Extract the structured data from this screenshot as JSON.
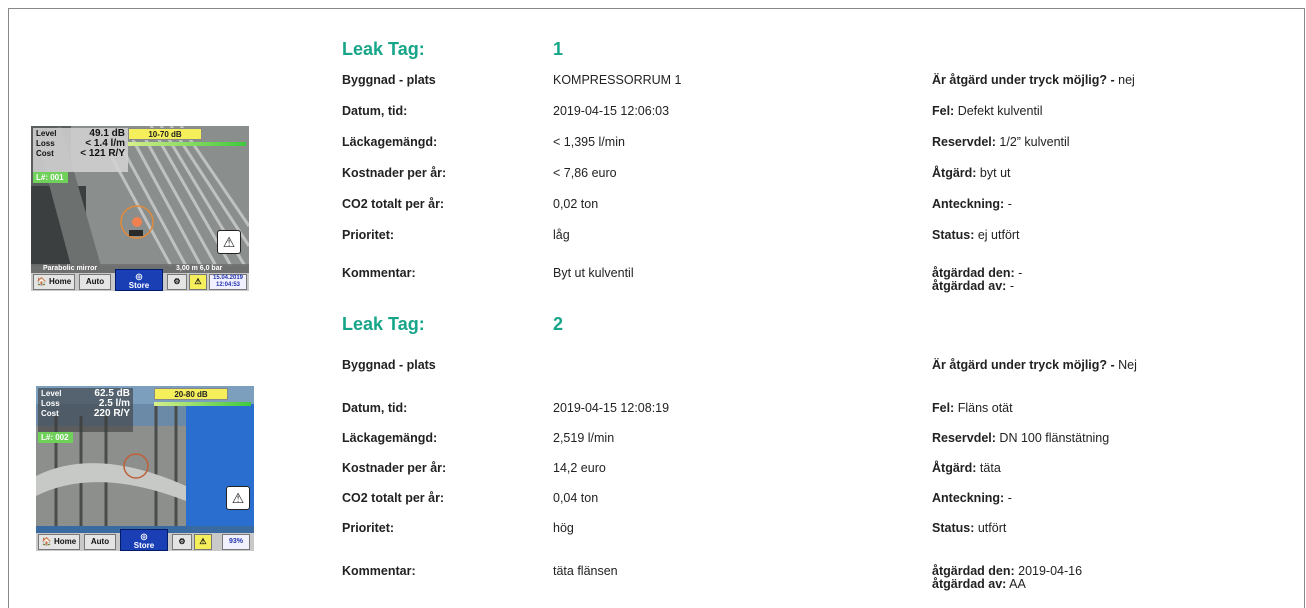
{
  "entries": [
    {
      "tag_label": "Leak Tag:",
      "tag_number": "1",
      "fields": {
        "building_label": "Byggnad - plats",
        "building_value": "KOMPRESSORRUM 1",
        "datetime_label": "Datum, tid:",
        "datetime_value": "2019-04-15 12:06:03",
        "leak_label": "Läckagemängd:",
        "leak_value": "< 1,395 l/min",
        "cost_label": "Kostnader per år:",
        "cost_value": "< 7,86 euro",
        "co2_label": "CO2 totalt per år:",
        "co2_value": "0,02 ton",
        "priority_label": "Prioritet:",
        "priority_value": "låg",
        "comment_label": "Kommentar:",
        "comment_value": "Byt ut kulventil"
      },
      "right": {
        "pressure_label": "Är åtgärd under tryck möjlig? -",
        "pressure_value": " nej",
        "fault_label": "Fel:",
        "fault_value": " Defekt kulventil",
        "part_label": "Reservdel:",
        "part_value": " 1/2” kulventil",
        "action_label": "Åtgärd:",
        "action_value": " byt ut",
        "note_label": "Anteckning:",
        "note_value": " -",
        "status_label": "Status:",
        "status_value": " ej utfört",
        "fixed_date_label": "åtgärdad den:",
        "fixed_date_value": " -",
        "fixed_by_label": "åtgärdad av:",
        "fixed_by_value": " -"
      },
      "thumbnail": {
        "level_label": "Level",
        "level_value": "49.1 dB",
        "loss_label": "Loss",
        "loss_value": "< 1.4 l/m",
        "cost_label": "Cost",
        "cost_value": "< 121 R/Y",
        "lnum": "L#: 001",
        "range": "10-70 dB",
        "mode_left": "Parabolic mirror",
        "mode_right": "3,00 m    6,0 bar",
        "home": "Home",
        "auto": "Auto",
        "store": "Store",
        "date_line1": "15.04.2019",
        "date_line2": "12:04:53"
      }
    },
    {
      "tag_label": "Leak Tag:",
      "tag_number": "2",
      "fields": {
        "building_label": "Byggnad - plats",
        "building_value": "",
        "datetime_label": "Datum, tid:",
        "datetime_value": "2019-04-15 12:08:19",
        "leak_label": "Läckagemängd:",
        "leak_value": "2,519 l/min",
        "cost_label": "Kostnader per år:",
        "cost_value": "14,2 euro",
        "co2_label": "CO2 totalt per år:",
        "co2_value": "0,04 ton",
        "priority_label": "Prioritet:",
        "priority_value": "hög",
        "comment_label": "Kommentar:",
        "comment_value": "täta flänsen"
      },
      "right": {
        "pressure_label": "Är åtgärd under tryck möjlig? -",
        "pressure_value": " Nej",
        "fault_label": "Fel:",
        "fault_value": " Fläns otät",
        "part_label": "Reservdel:",
        "part_value": " DN 100 flänstätning",
        "action_label": "Åtgärd:",
        "action_value": " täta",
        "note_label": "Anteckning:",
        "note_value": " -",
        "status_label": "Status:",
        "status_value": " utfört",
        "fixed_date_label": "åtgärdad den:",
        "fixed_date_value": " 2019-04-16",
        "fixed_by_label": "åtgärdad av:",
        "fixed_by_value": " AA"
      },
      "thumbnail": {
        "level_label": "Level",
        "level_value": "62.5 dB",
        "loss_label": "Loss",
        "loss_value": "2.5 l/m",
        "cost_label": "Cost",
        "cost_value": "220 R/Y",
        "lnum": "L#: 002",
        "range": "20-80 dB",
        "home": "Home",
        "auto": "Auto",
        "store": "Store",
        "battery": "93%"
      }
    }
  ]
}
